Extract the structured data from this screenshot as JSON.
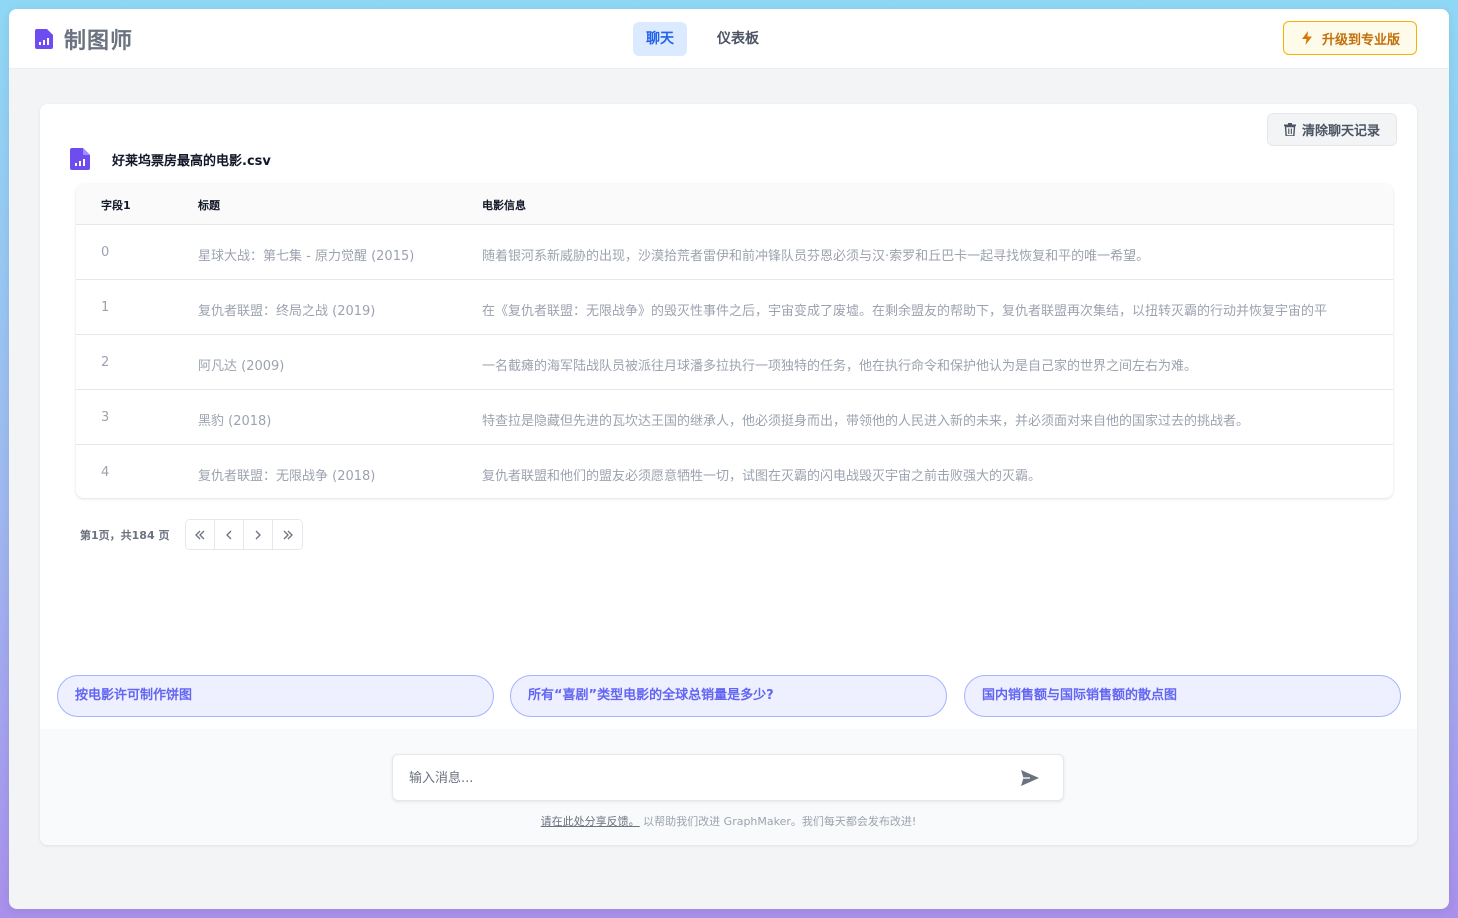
{
  "app": {
    "name": "制图师",
    "upgrade_label": "升级到专业版"
  },
  "nav": {
    "tabs": [
      {
        "label": "聊天",
        "active": true
      },
      {
        "label": "仪表板",
        "active": false
      }
    ]
  },
  "chat": {
    "clear_label": "清除聊天记录",
    "file_name": "好莱坞票房最高的电影.csv",
    "table": {
      "columns": [
        "字段1",
        "标题",
        "电影信息"
      ],
      "rows": [
        [
          "0",
          "星球大战：第七集 - 原力觉醒 (2015)",
          "随着银河系新威胁的出现，沙漠拾荒者雷伊和前冲锋队员芬恩必须与汉·索罗和丘巴卡一起寻找恢复和平的唯一希望。"
        ],
        [
          "1",
          "复仇者联盟：终局之战 (2019)",
          "在《复仇者联盟：无限战争》的毁灭性事件之后，宇宙变成了废墟。在剩余盟友的帮助下，复仇者联盟再次集结，以扭转灭霸的行动并恢复宇宙的平"
        ],
        [
          "2",
          "阿凡达 (2009)",
          "一名截瘫的海军陆战队员被派往月球潘多拉执行一项独特的任务，他在执行命令和保护他认为是自己家的世界之间左右为难。"
        ],
        [
          "3",
          "黑豹 (2018)",
          "特查拉是隐藏但先进的瓦坎达王国的继承人，他必须挺身而出，带领他的人民进入新的未来，并必须面对来自他的国家过去的挑战者。"
        ],
        [
          "4",
          "复仇者联盟：无限战争 (2018)",
          "复仇者联盟和他们的盟友必须愿意牺牲一切，试图在灭霸的闪电战毁灭宇宙之前击败强大的灭霸。"
        ]
      ]
    },
    "pagination": {
      "text": "第1页，共184 页"
    },
    "suggestions": [
      "按电影许可制作饼图",
      "所有“喜剧”类型电影的全球总销量是多少?",
      "国内销售额与国际销售额的散点图"
    ],
    "input_placeholder": "输入消息...",
    "feedback": {
      "link": "请在此处分享反馈。",
      "text": " 以帮助我们改进 GraphMaker。我们每天都会发布改进!"
    }
  },
  "colors": {
    "accent": "#6366f1",
    "nav_active_bg": "#dbeafe",
    "upgrade_border": "#f5b400"
  }
}
